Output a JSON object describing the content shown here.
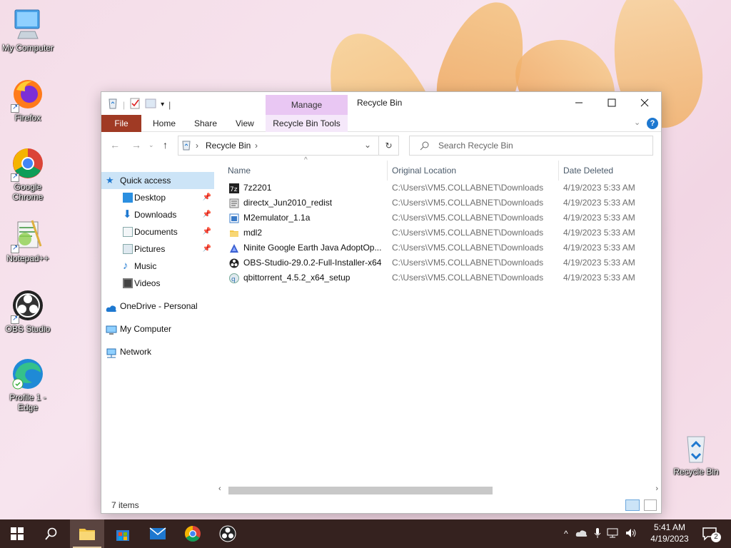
{
  "desktop": {
    "icons": [
      {
        "label": "My Computer",
        "icon": "monitor-icon"
      },
      {
        "label": "Firefox",
        "icon": "firefox-icon"
      },
      {
        "label": "Google Chrome",
        "icon": "chrome-icon"
      },
      {
        "label": "Notepad++",
        "icon": "notepadpp-icon"
      },
      {
        "label": "OBS Studio",
        "icon": "obs-icon"
      },
      {
        "label": "Profile 1 - Edge",
        "icon": "edge-icon"
      }
    ],
    "recycle_bin_label": "Recycle Bin"
  },
  "window": {
    "title": "Recycle Bin",
    "manage_tab": "Manage",
    "ribbon_tabs": [
      "File",
      "Home",
      "Share",
      "View",
      "Recycle Bin Tools"
    ],
    "address": {
      "path_item": "Recycle Bin",
      "sep": "›"
    },
    "search_placeholder": "Search Recycle Bin",
    "nav": {
      "quick_access": "Quick access",
      "quick_items": [
        "Desktop",
        "Downloads",
        "Documents",
        "Pictures",
        "Music",
        "Videos"
      ],
      "onedrive": "OneDrive - Personal",
      "my_computer": "My Computer",
      "network": "Network"
    },
    "columns": {
      "name": "Name",
      "location": "Original Location",
      "date": "Date Deleted"
    },
    "files": [
      {
        "name": "7z2201",
        "location": "C:\\Users\\VM5.COLLABNET\\Downloads",
        "date": "4/19/2023 5:33 AM",
        "icon": "7zip-icon"
      },
      {
        "name": "directx_Jun2010_redist",
        "location": "C:\\Users\\VM5.COLLABNET\\Downloads",
        "date": "4/19/2023 5:33 AM",
        "icon": "installer-icon"
      },
      {
        "name": "M2emulator_1.1a",
        "location": "C:\\Users\\VM5.COLLABNET\\Downloads",
        "date": "4/19/2023 5:33 AM",
        "icon": "app-icon"
      },
      {
        "name": "mdl2",
        "location": "C:\\Users\\VM5.COLLABNET\\Downloads",
        "date": "4/19/2023 5:33 AM",
        "icon": "folder-icon"
      },
      {
        "name": "Ninite Google Earth Java AdoptOp...",
        "location": "C:\\Users\\VM5.COLLABNET\\Downloads",
        "date": "4/19/2023 5:33 AM",
        "icon": "ninite-icon"
      },
      {
        "name": "OBS-Studio-29.0.2-Full-Installer-x64",
        "location": "C:\\Users\\VM5.COLLABNET\\Downloads",
        "date": "4/19/2023 5:33 AM",
        "icon": "obs-icon"
      },
      {
        "name": "qbittorrent_4.5.2_x64_setup",
        "location": "C:\\Users\\VM5.COLLABNET\\Downloads",
        "date": "4/19/2023 5:33 AM",
        "icon": "qbittorrent-icon"
      }
    ],
    "status": "7 items"
  },
  "taskbar": {
    "time": "5:41 AM",
    "date": "4/19/2023",
    "notification_count": "2"
  }
}
